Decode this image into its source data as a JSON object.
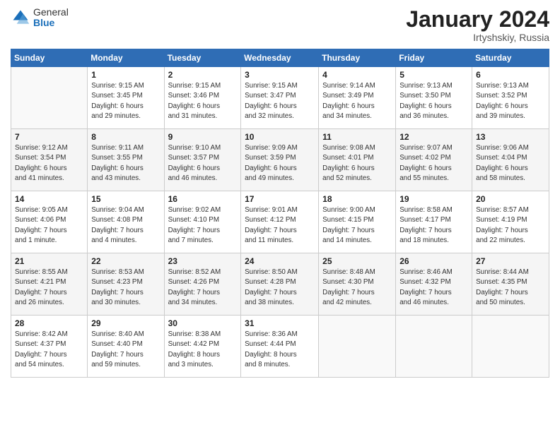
{
  "header": {
    "logo_general": "General",
    "logo_blue": "Blue",
    "month_title": "January 2024",
    "location": "Irtyshskiy, Russia"
  },
  "weekdays": [
    "Sunday",
    "Monday",
    "Tuesday",
    "Wednesday",
    "Thursday",
    "Friday",
    "Saturday"
  ],
  "weeks": [
    [
      {
        "day": "",
        "info": ""
      },
      {
        "day": "1",
        "info": "Sunrise: 9:15 AM\nSunset: 3:45 PM\nDaylight: 6 hours\nand 29 minutes."
      },
      {
        "day": "2",
        "info": "Sunrise: 9:15 AM\nSunset: 3:46 PM\nDaylight: 6 hours\nand 31 minutes."
      },
      {
        "day": "3",
        "info": "Sunrise: 9:15 AM\nSunset: 3:47 PM\nDaylight: 6 hours\nand 32 minutes."
      },
      {
        "day": "4",
        "info": "Sunrise: 9:14 AM\nSunset: 3:49 PM\nDaylight: 6 hours\nand 34 minutes."
      },
      {
        "day": "5",
        "info": "Sunrise: 9:13 AM\nSunset: 3:50 PM\nDaylight: 6 hours\nand 36 minutes."
      },
      {
        "day": "6",
        "info": "Sunrise: 9:13 AM\nSunset: 3:52 PM\nDaylight: 6 hours\nand 39 minutes."
      }
    ],
    [
      {
        "day": "7",
        "info": "Sunrise: 9:12 AM\nSunset: 3:54 PM\nDaylight: 6 hours\nand 41 minutes."
      },
      {
        "day": "8",
        "info": "Sunrise: 9:11 AM\nSunset: 3:55 PM\nDaylight: 6 hours\nand 43 minutes."
      },
      {
        "day": "9",
        "info": "Sunrise: 9:10 AM\nSunset: 3:57 PM\nDaylight: 6 hours\nand 46 minutes."
      },
      {
        "day": "10",
        "info": "Sunrise: 9:09 AM\nSunset: 3:59 PM\nDaylight: 6 hours\nand 49 minutes."
      },
      {
        "day": "11",
        "info": "Sunrise: 9:08 AM\nSunset: 4:01 PM\nDaylight: 6 hours\nand 52 minutes."
      },
      {
        "day": "12",
        "info": "Sunrise: 9:07 AM\nSunset: 4:02 PM\nDaylight: 6 hours\nand 55 minutes."
      },
      {
        "day": "13",
        "info": "Sunrise: 9:06 AM\nSunset: 4:04 PM\nDaylight: 6 hours\nand 58 minutes."
      }
    ],
    [
      {
        "day": "14",
        "info": "Sunrise: 9:05 AM\nSunset: 4:06 PM\nDaylight: 7 hours\nand 1 minute."
      },
      {
        "day": "15",
        "info": "Sunrise: 9:04 AM\nSunset: 4:08 PM\nDaylight: 7 hours\nand 4 minutes."
      },
      {
        "day": "16",
        "info": "Sunrise: 9:02 AM\nSunset: 4:10 PM\nDaylight: 7 hours\nand 7 minutes."
      },
      {
        "day": "17",
        "info": "Sunrise: 9:01 AM\nSunset: 4:12 PM\nDaylight: 7 hours\nand 11 minutes."
      },
      {
        "day": "18",
        "info": "Sunrise: 9:00 AM\nSunset: 4:15 PM\nDaylight: 7 hours\nand 14 minutes."
      },
      {
        "day": "19",
        "info": "Sunrise: 8:58 AM\nSunset: 4:17 PM\nDaylight: 7 hours\nand 18 minutes."
      },
      {
        "day": "20",
        "info": "Sunrise: 8:57 AM\nSunset: 4:19 PM\nDaylight: 7 hours\nand 22 minutes."
      }
    ],
    [
      {
        "day": "21",
        "info": "Sunrise: 8:55 AM\nSunset: 4:21 PM\nDaylight: 7 hours\nand 26 minutes."
      },
      {
        "day": "22",
        "info": "Sunrise: 8:53 AM\nSunset: 4:23 PM\nDaylight: 7 hours\nand 30 minutes."
      },
      {
        "day": "23",
        "info": "Sunrise: 8:52 AM\nSunset: 4:26 PM\nDaylight: 7 hours\nand 34 minutes."
      },
      {
        "day": "24",
        "info": "Sunrise: 8:50 AM\nSunset: 4:28 PM\nDaylight: 7 hours\nand 38 minutes."
      },
      {
        "day": "25",
        "info": "Sunrise: 8:48 AM\nSunset: 4:30 PM\nDaylight: 7 hours\nand 42 minutes."
      },
      {
        "day": "26",
        "info": "Sunrise: 8:46 AM\nSunset: 4:32 PM\nDaylight: 7 hours\nand 46 minutes."
      },
      {
        "day": "27",
        "info": "Sunrise: 8:44 AM\nSunset: 4:35 PM\nDaylight: 7 hours\nand 50 minutes."
      }
    ],
    [
      {
        "day": "28",
        "info": "Sunrise: 8:42 AM\nSunset: 4:37 PM\nDaylight: 7 hours\nand 54 minutes."
      },
      {
        "day": "29",
        "info": "Sunrise: 8:40 AM\nSunset: 4:40 PM\nDaylight: 7 hours\nand 59 minutes."
      },
      {
        "day": "30",
        "info": "Sunrise: 8:38 AM\nSunset: 4:42 PM\nDaylight: 8 hours\nand 3 minutes."
      },
      {
        "day": "31",
        "info": "Sunrise: 8:36 AM\nSunset: 4:44 PM\nDaylight: 8 hours\nand 8 minutes."
      },
      {
        "day": "",
        "info": ""
      },
      {
        "day": "",
        "info": ""
      },
      {
        "day": "",
        "info": ""
      }
    ]
  ]
}
